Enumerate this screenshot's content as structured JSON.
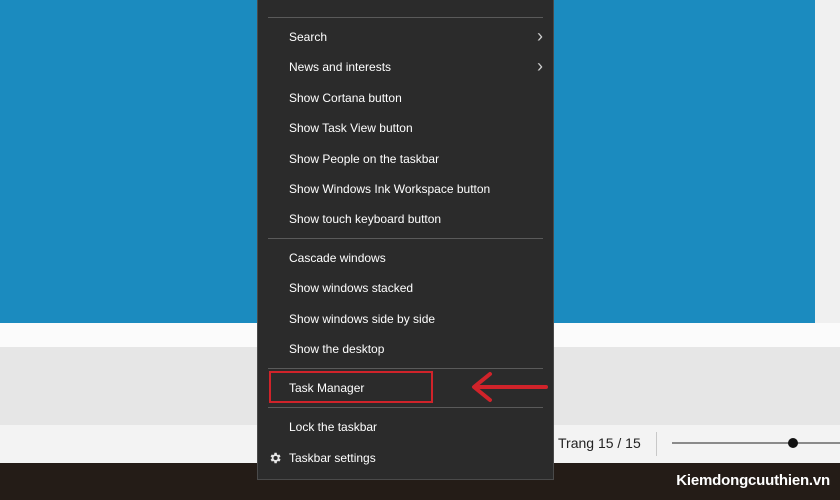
{
  "context_menu": {
    "items": [
      {
        "label": "Search",
        "has_submenu": true
      },
      {
        "label": "News and interests",
        "has_submenu": true
      },
      {
        "label": "Show Cortana button"
      },
      {
        "label": "Show Task View button"
      },
      {
        "label": "Show People on the taskbar"
      },
      {
        "label": "Show Windows Ink Workspace button"
      },
      {
        "label": "Show touch keyboard button"
      },
      {
        "label": "Cascade windows"
      },
      {
        "label": "Show windows stacked"
      },
      {
        "label": "Show windows side by side"
      },
      {
        "label": "Show the desktop"
      },
      {
        "label": "Task Manager",
        "highlighted": true
      },
      {
        "label": "Lock the taskbar"
      },
      {
        "label": "Taskbar settings",
        "icon": "gear-icon"
      }
    ],
    "submenu_glyph": "›"
  },
  "status_bar": {
    "page_info": "Trang 15 / 15"
  },
  "watermark": "Kiemdongcuuthien.vn",
  "colors": {
    "accent_blue": "#1b8bbf",
    "menu_bg": "#2b2b2b",
    "highlight_red": "#d0232a",
    "taskbar_bg": "#241c17"
  }
}
